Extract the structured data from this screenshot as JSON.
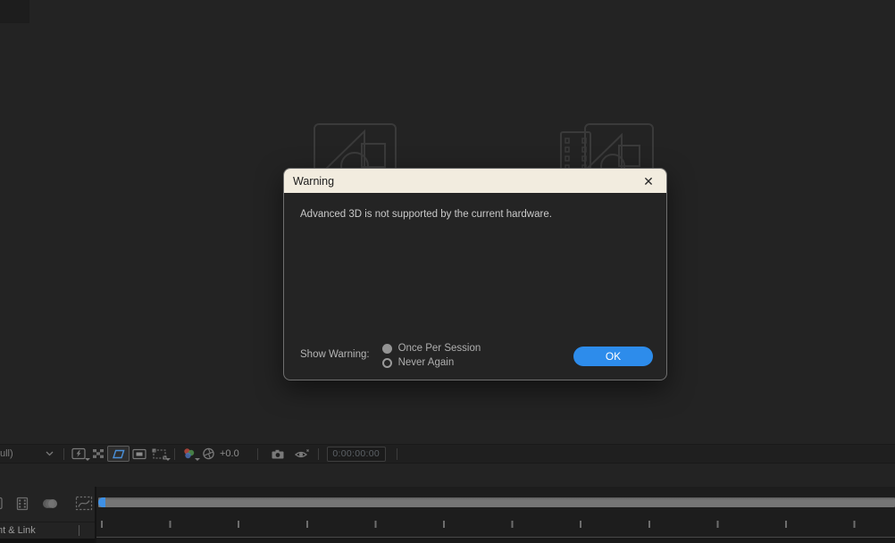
{
  "dialog": {
    "title": "Warning",
    "close_glyph": "✕",
    "message": "Advanced 3D is not supported by the current hardware.",
    "show_warning_label": "Show Warning:",
    "options": [
      {
        "label": "Once Per Session",
        "selected": true
      },
      {
        "label": "Never Again",
        "selected": false
      }
    ],
    "ok_label": "OK",
    "titlebar_color": "#f2ecdf",
    "accent_color": "#2d8ceb"
  },
  "viewer_toolbar": {
    "resolution_partial_label": "ull)",
    "exposure_value": "+0.0",
    "timecode": "0:00:00:00",
    "icons": [
      "fast-preview-icon",
      "transparency-grid-icon",
      "mask-visibility-icon",
      "region-of-interest-icon",
      "crop-region-icon",
      "channel-rgb-icon",
      "exposure-aperture-icon",
      "snapshot-camera-icon",
      "show-snapshot-eye-icon"
    ]
  },
  "timeline": {
    "parent_link_partial_label": "nt & Link",
    "icons": [
      "film-frames-icon",
      "motion-blur-icon",
      "graph-editor-icon"
    ],
    "playhead_color": "#3e90e5"
  },
  "colors": {
    "background": "#232323",
    "toolbar_bg": "#1f1f1f",
    "timeline_bg": "#1d1d1d",
    "scrollbar_gray": "#757575",
    "placeholder_outline": "#3a3a3a"
  }
}
